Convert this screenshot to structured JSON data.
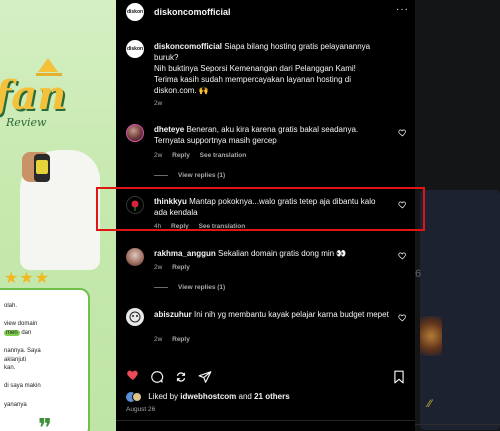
{
  "post": {
    "username": "diskoncomofficial",
    "avatar_text": "diskon",
    "more_label": "···"
  },
  "left_image": {
    "brand": "fan",
    "review": "Review",
    "stars": "★★★",
    "card_lines": [
      "olah.",
      "view domain",
      "men",
      "dan",
      "nannya. Saya",
      "aklanjuti",
      "kan.",
      "di saya makin",
      "yananya"
    ]
  },
  "right_panel": {
    "number": "6"
  },
  "comments": [
    {
      "username": "diskoncomofficial",
      "text": "Siapa bilang hosting gratis pelayanannya buruk?\nNih buktinya Seporsi Kemenangan dari Pelanggan Kami!\nTerima kasih sudah mempercayakan layanan hosting di diskon.com. 🙌",
      "time": "2w"
    },
    {
      "username": "dheteye",
      "text": "Beneran, aku kira karena gratis bakal seadanya. Ternyata supportnya masih gercep",
      "time": "2w",
      "reply": "Reply",
      "translate": "See translation",
      "view_replies": "View replies (1)"
    },
    {
      "username": "thinkkyu",
      "text": "Mantap pokoknya...walo gratis tetep aja dibantu kalo ada kendala",
      "time": "4h",
      "reply": "Reply",
      "translate": "See translation"
    },
    {
      "username": "rakhma_anggun",
      "text": "Sekalian domain gratis dong min 👀",
      "time": "2w",
      "reply": "Reply",
      "view_replies": "View replies (1)"
    },
    {
      "username": "abiszuhur",
      "text": "Ini nih yg membantu kayak pelajar karna budget mepet",
      "time": "2w",
      "reply": "Reply"
    }
  ],
  "footer": {
    "liked_prefix": "Liked by",
    "liked_user": "idwebhostcom",
    "liked_and": "and",
    "liked_others": "21 others",
    "date": "August 26"
  },
  "colors": {
    "like_active": "#ed4956",
    "highlight_border": "#e01515",
    "panel_bg": "#000000"
  }
}
